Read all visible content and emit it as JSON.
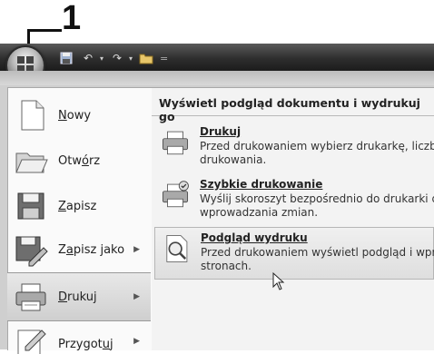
{
  "callout": {
    "number": "1"
  },
  "quick_access": {
    "separator": "="
  },
  "menu": {
    "items": [
      {
        "label": "Nowy",
        "underline": "N",
        "rest": "owy",
        "icon": "new-document-icon",
        "has_submenu": false
      },
      {
        "label": "Otwórz",
        "pre": "Otw",
        "underline": "ó",
        "rest": "rz",
        "icon": "open-folder-icon",
        "has_submenu": false
      },
      {
        "label": "Zapisz",
        "underline": "Z",
        "rest": "apisz",
        "icon": "save-icon",
        "has_submenu": false
      },
      {
        "label": "Zapisz jako",
        "pre": "Z",
        "underline": "a",
        "rest": "pisz jako",
        "icon": "save-as-icon",
        "has_submenu": true
      },
      {
        "label": "Drukuj",
        "underline": "D",
        "rest": "rukuj",
        "icon": "printer-icon",
        "has_submenu": true
      },
      {
        "label": "Przygotuj",
        "pre": "Przygot",
        "underline": "u",
        "rest": "j",
        "icon": "prepare-icon",
        "has_submenu": true
      }
    ]
  },
  "submenu": {
    "header": "Wyświetl podgląd dokumentu i wydrukuj go",
    "items": [
      {
        "title": "Drukuj",
        "desc1": "Przed drukowaniem wybierz drukarkę, liczbę",
        "desc2": "drukowania.",
        "icon": "printer-icon"
      },
      {
        "title": "Szybkie drukowanie",
        "desc1": "Wyślij skoroszyt bezpośrednio do drukarki d",
        "desc2": "wprowadzania zmian.",
        "icon": "quick-print-icon"
      },
      {
        "title": "Podgląd wydruku",
        "desc1": "Przed drukowaniem wyświetl podgląd i wpr",
        "desc2": "stronach.",
        "icon": "print-preview-icon"
      }
    ]
  }
}
